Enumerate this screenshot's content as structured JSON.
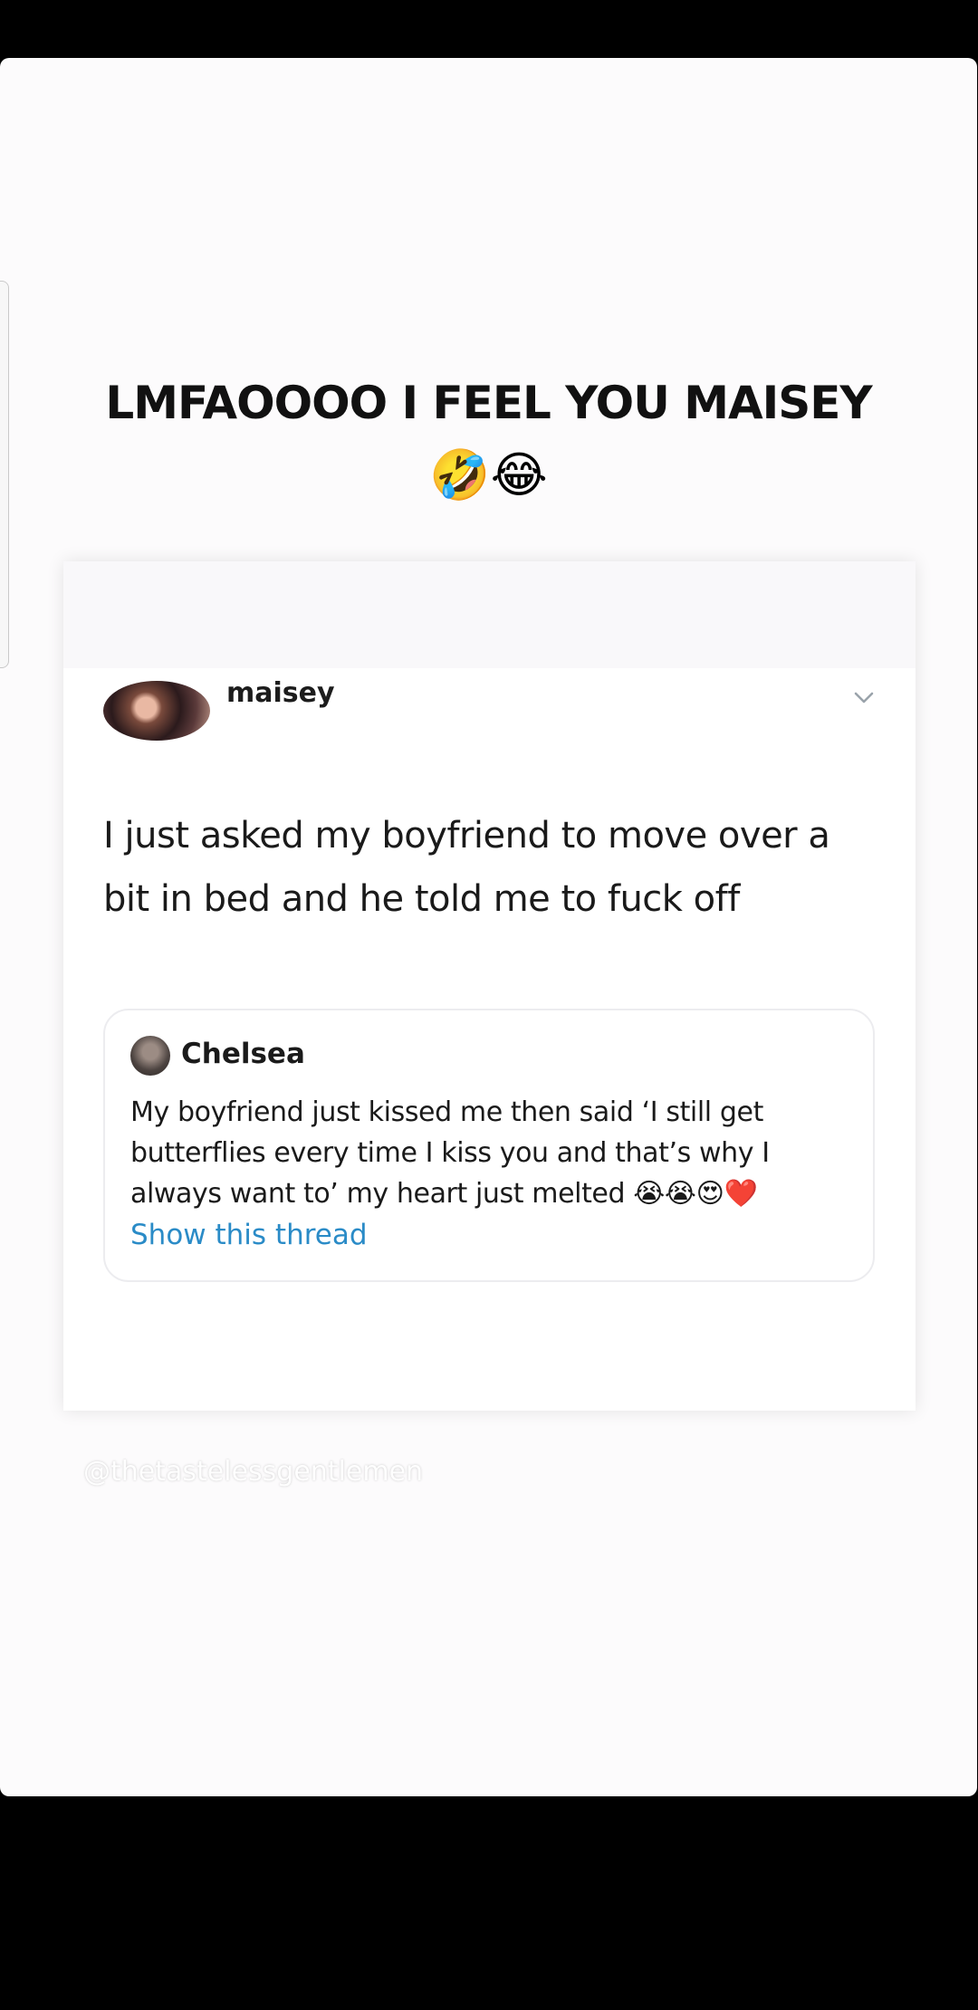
{
  "caption": {
    "text": "LMFAOOOO I FEEL YOU MAISEY",
    "emoji": "🤣😂"
  },
  "post": {
    "username": "maisey",
    "text": "I just asked my boyfriend to move over a bit in bed and he told me to fuck off",
    "menu_icon": "chevron-down-icon"
  },
  "quoted_post": {
    "name": "Chelsea",
    "text": "My boyfriend just kissed me then said ‘I still get butterflies every time I kiss you and that’s why I always want to’ my heart just melted 😭😭😍❤️",
    "link_text": "Show this thread",
    "link_color": "#2a8bc7"
  },
  "watermark": "@thetastelessgentlemen",
  "colors": {
    "background": "#000000",
    "sheet": "#fcfbfc",
    "card": "#ffffff",
    "text": "#1a1a1a"
  }
}
